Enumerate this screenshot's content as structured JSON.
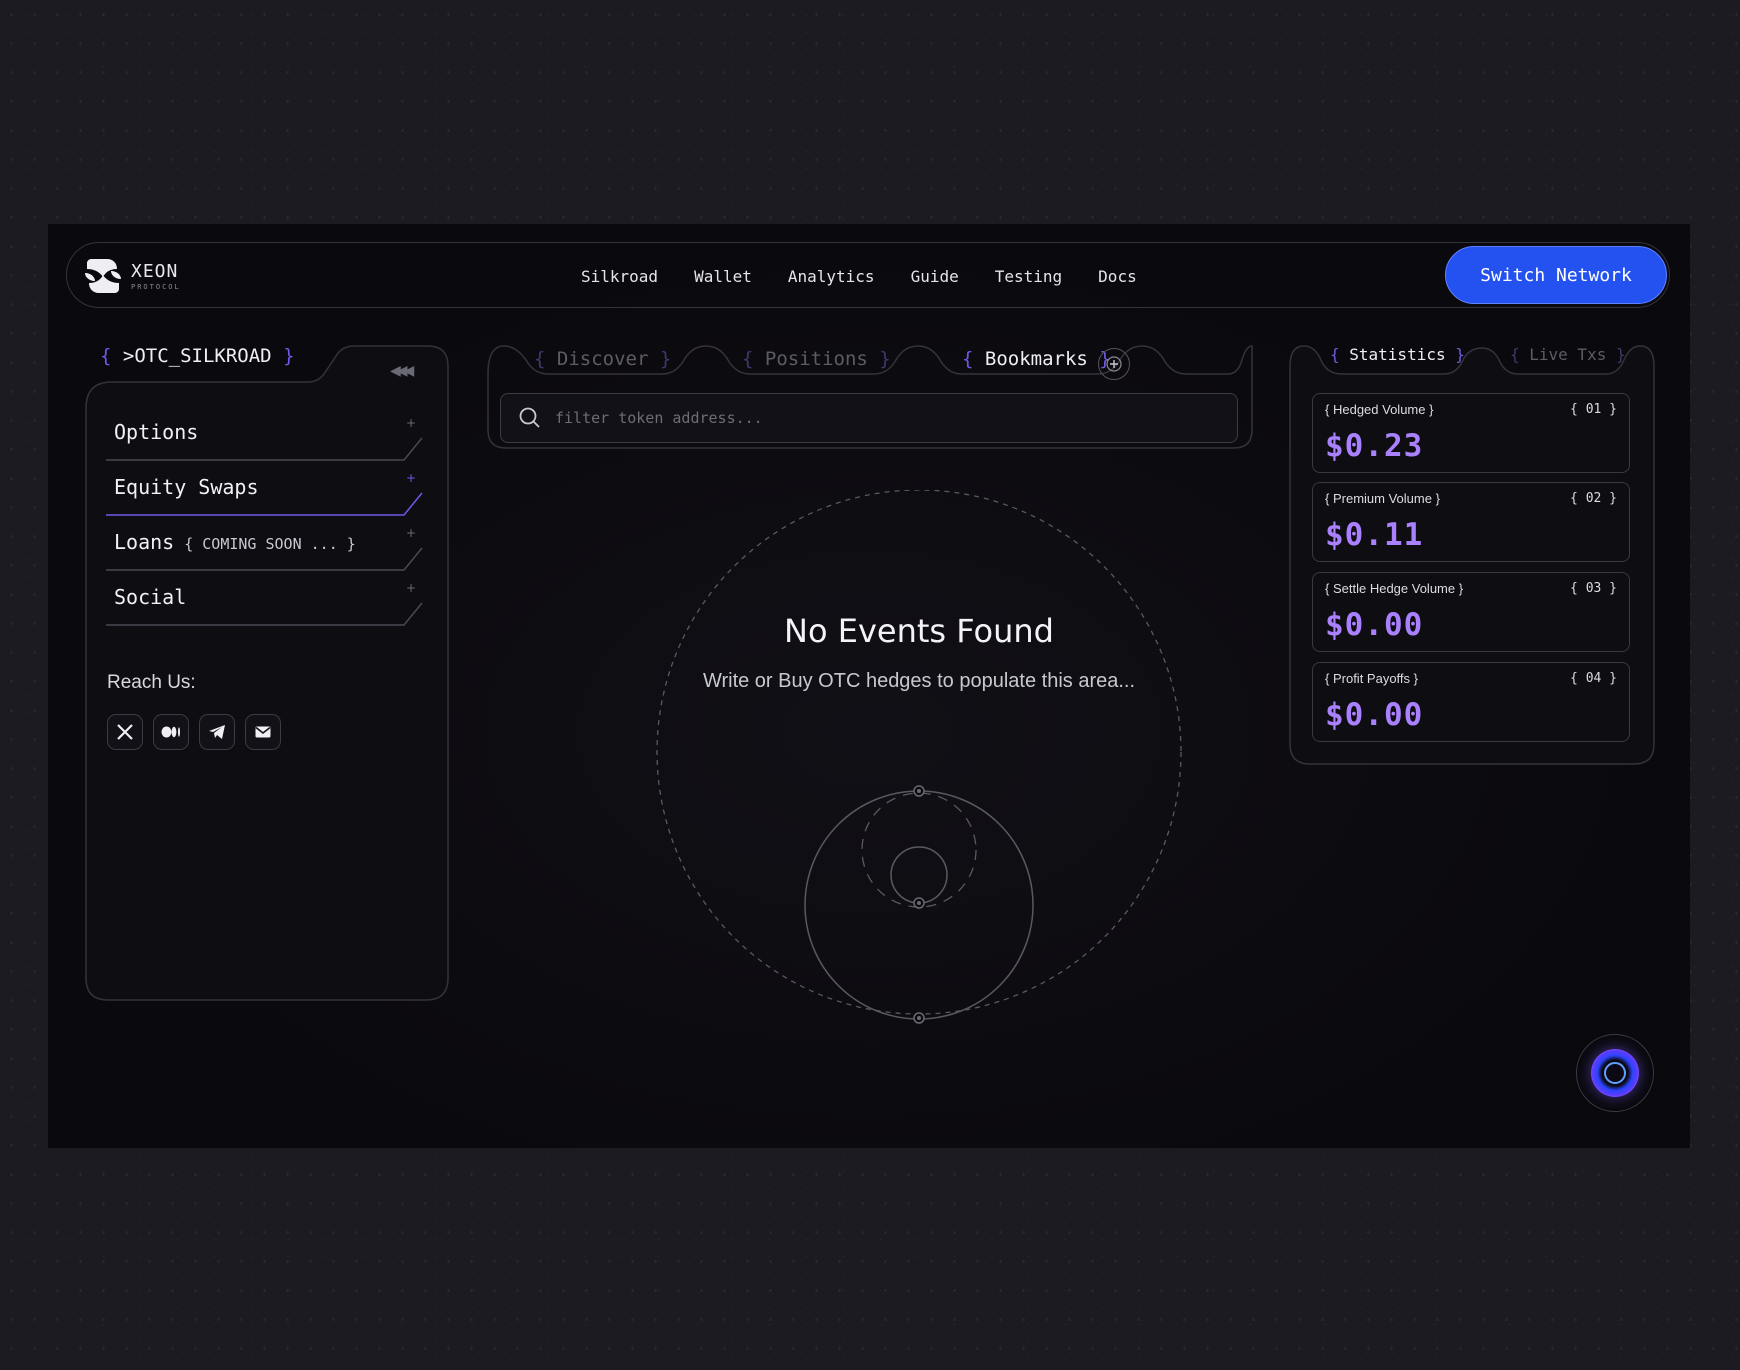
{
  "header": {
    "brand_name": "XEON",
    "brand_sub": "PROTOCOL",
    "nav": [
      "Silkroad",
      "Wallet",
      "Analytics",
      "Guide",
      "Testing",
      "Docs"
    ],
    "cta_label": "Switch Network"
  },
  "sidebar": {
    "title": ">OTC_SILKROAD",
    "items": [
      {
        "label": "Options",
        "tag": ""
      },
      {
        "label": "Equity Swaps",
        "tag": ""
      },
      {
        "label": "Loans",
        "tag": "{ COMING SOON ... }"
      },
      {
        "label": "Social",
        "tag": ""
      }
    ],
    "reach_label": "Reach Us:",
    "socials": [
      "x-icon",
      "medium-icon",
      "telegram-icon",
      "mail-icon"
    ]
  },
  "main": {
    "tabs": [
      "Discover",
      "Positions",
      "Bookmarks"
    ],
    "active_tab": "Bookmarks",
    "search_placeholder": "filter token address...",
    "empty_title": "No Events Found",
    "empty_subtitle": "Write or Buy OTC hedges to populate this area..."
  },
  "stats": {
    "tabs": [
      "Statistics",
      "Live Txs"
    ],
    "active_tab": "Statistics",
    "cards": [
      {
        "label": "Hedged Volume",
        "num": "01",
        "value": "$0.23"
      },
      {
        "label": "Premium Volume",
        "num": "02",
        "value": "$0.11"
      },
      {
        "label": "Settle Hedge Volume",
        "num": "03",
        "value": "$0.00"
      },
      {
        "label": "Profit Payoffs",
        "num": "04",
        "value": "$0.00"
      }
    ]
  },
  "colors": {
    "accent_blue": "#2452f0",
    "accent_purple": "#a981ff",
    "bracket_purple": "#6b5be6",
    "background": "#0b0a0f"
  }
}
